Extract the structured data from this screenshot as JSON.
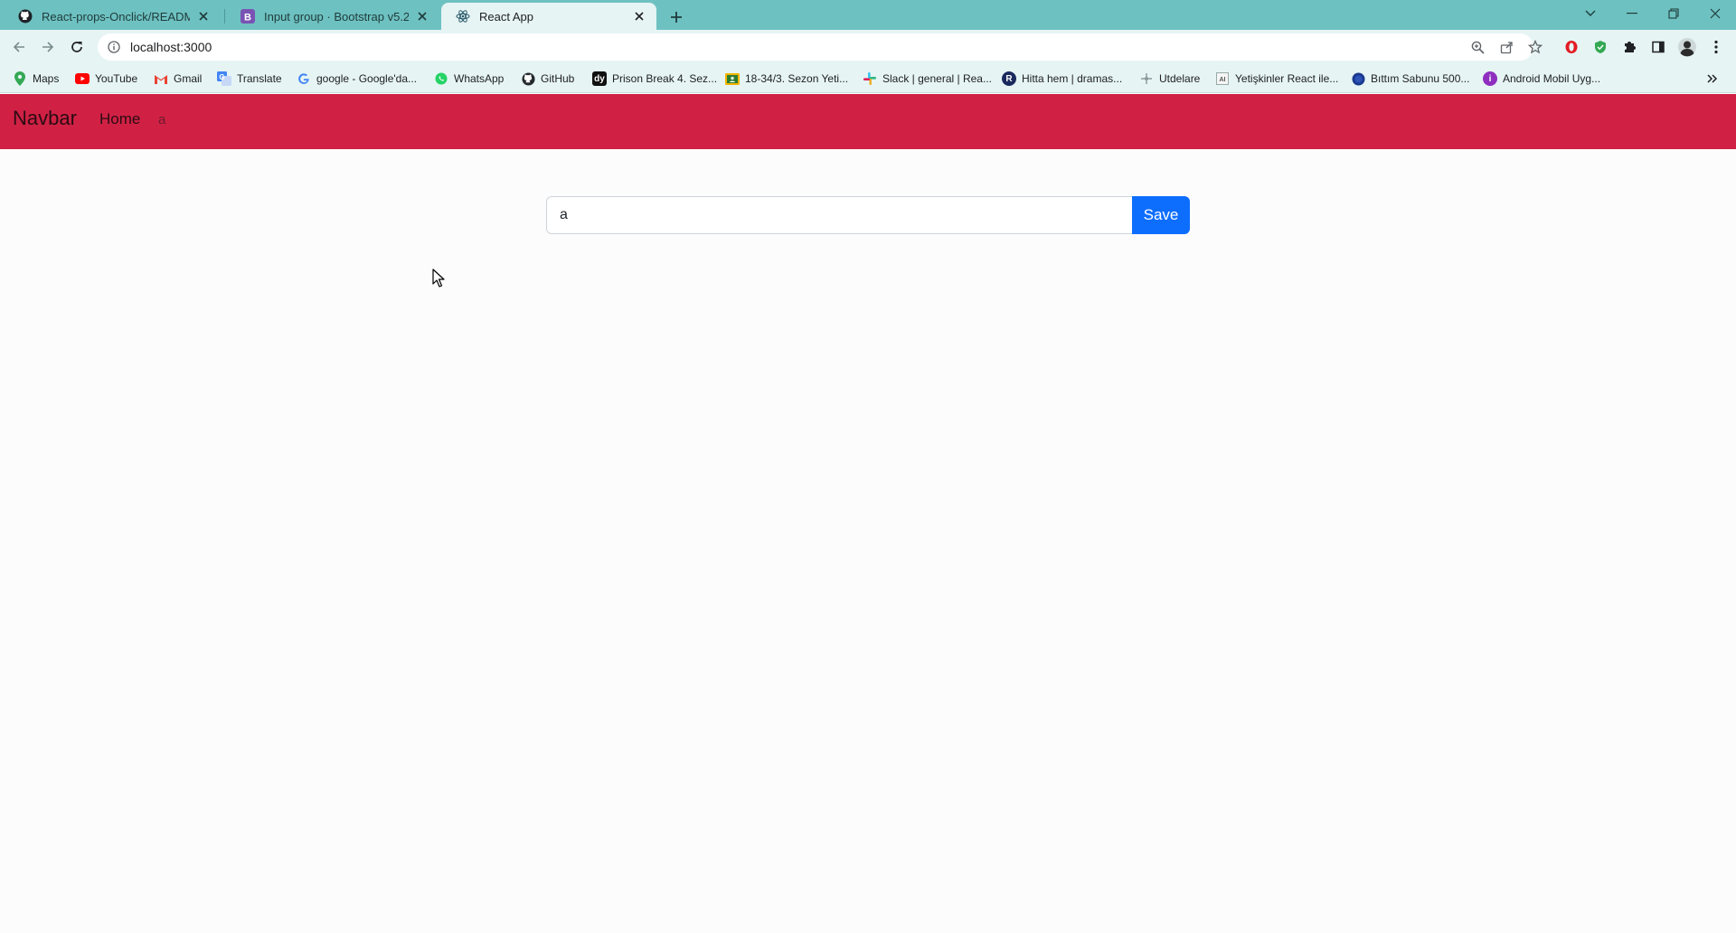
{
  "browser": {
    "tabs": [
      {
        "title": "React-props-Onclick/README.m",
        "icon": "github-icon",
        "active": false
      },
      {
        "title": "Input group · Bootstrap v5.2",
        "icon": "bootstrap-icon",
        "active": false
      },
      {
        "title": "React App",
        "icon": "react-icon",
        "active": true
      }
    ],
    "url": "localhost:3000",
    "bookmarks": [
      {
        "label": "Maps",
        "icon": "maps-icon",
        "color": "#34a853"
      },
      {
        "label": "YouTube",
        "icon": "youtube-icon",
        "color": "#ff0000"
      },
      {
        "label": "Gmail",
        "icon": "gmail-icon",
        "color": "#ea4335"
      },
      {
        "label": "Translate",
        "icon": "translate-icon",
        "color": "#4285f4"
      },
      {
        "label": "google - Google'da...",
        "icon": "google-icon",
        "color": "#4285f4"
      },
      {
        "label": "WhatsApp",
        "icon": "whatsapp-icon",
        "color": "#25d366"
      },
      {
        "label": "GitHub",
        "icon": "github-icon",
        "color": "#24292e"
      },
      {
        "label": "Prison Break 4. Sez...",
        "icon": "dizi-icon",
        "color": "#111111"
      },
      {
        "label": "18-34/3. Sezon Yeti...",
        "icon": "classroom-icon",
        "color": "#f4b400"
      },
      {
        "label": "Slack | general | Rea...",
        "icon": "slack-icon",
        "color": "#e01e5a"
      },
      {
        "label": "Hitta hem | dramas...",
        "icon": "hitta-icon",
        "color": "#1a2a5e"
      },
      {
        "label": "Utdelare",
        "icon": "utdelare-icon",
        "color": "#5f6368"
      },
      {
        "label": "Yetişkinler React ile...",
        "icon": "udemy-icon",
        "color": "#5f6368"
      },
      {
        "label": "Bıttım Sabunu 500...",
        "icon": "shop-icon",
        "color": "#1a3a8f"
      },
      {
        "label": "Android Mobil Uyg...",
        "icon": "android-course-icon",
        "color": "#8e2fbf"
      }
    ]
  },
  "navbar": {
    "brand": "Navbar",
    "links": [
      "Home",
      "a"
    ],
    "background": "#d02145"
  },
  "form": {
    "input_value": "a",
    "save_label": "Save",
    "button_color": "#0d6efd"
  }
}
